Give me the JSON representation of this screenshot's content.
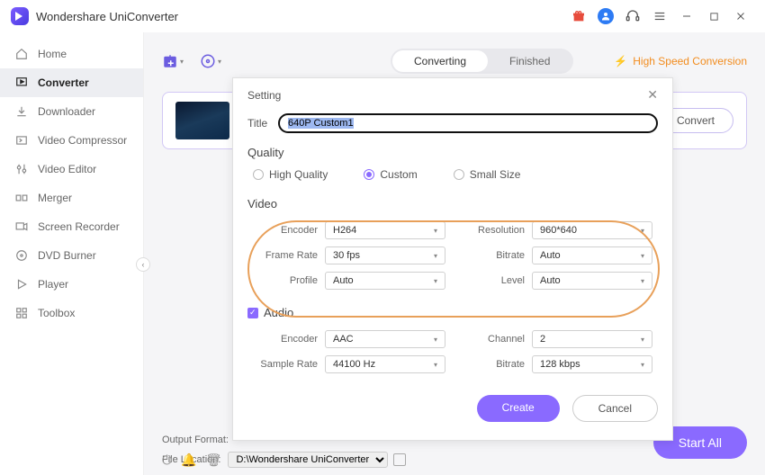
{
  "titlebar": {
    "title": "Wondershare UniConverter"
  },
  "sidebar": {
    "items": [
      {
        "label": "Home"
      },
      {
        "label": "Converter"
      },
      {
        "label": "Downloader"
      },
      {
        "label": "Video Compressor"
      },
      {
        "label": "Video Editor"
      },
      {
        "label": "Merger"
      },
      {
        "label": "Screen Recorder"
      },
      {
        "label": "DVD Burner"
      },
      {
        "label": "Player"
      },
      {
        "label": "Toolbox"
      }
    ]
  },
  "topbar": {
    "tabs": {
      "converting": "Converting",
      "finished": "Finished"
    },
    "high_speed": "High Speed Conversion"
  },
  "card": {
    "convert": "Convert"
  },
  "bottombar": {
    "output_format_label": "Output Format:",
    "file_location_label": "File Location:",
    "file_location_value": "D:\\Wondershare UniConverter",
    "start_all": "Start All"
  },
  "modal": {
    "title": "Setting",
    "title_label": "Title",
    "title_value": "640P Custom1",
    "quality_label": "Quality",
    "quality_options": {
      "high": "High Quality",
      "custom": "Custom",
      "small": "Small Size"
    },
    "video_label": "Video",
    "video": {
      "encoder_label": "Encoder",
      "encoder_value": "H264",
      "resolution_label": "Resolution",
      "resolution_value": "960*640",
      "framerate_label": "Frame Rate",
      "framerate_value": "30 fps",
      "bitrate_label": "Bitrate",
      "bitrate_value": "Auto",
      "profile_label": "Profile",
      "profile_value": "Auto",
      "level_label": "Level",
      "level_value": "Auto"
    },
    "audio_label": "Audio",
    "audio": {
      "encoder_label": "Encoder",
      "encoder_value": "AAC",
      "channel_label": "Channel",
      "channel_value": "2",
      "samplerate_label": "Sample Rate",
      "samplerate_value": "44100 Hz",
      "bitrate_label": "Bitrate",
      "bitrate_value": "128 kbps"
    },
    "create": "Create",
    "cancel": "Cancel"
  }
}
